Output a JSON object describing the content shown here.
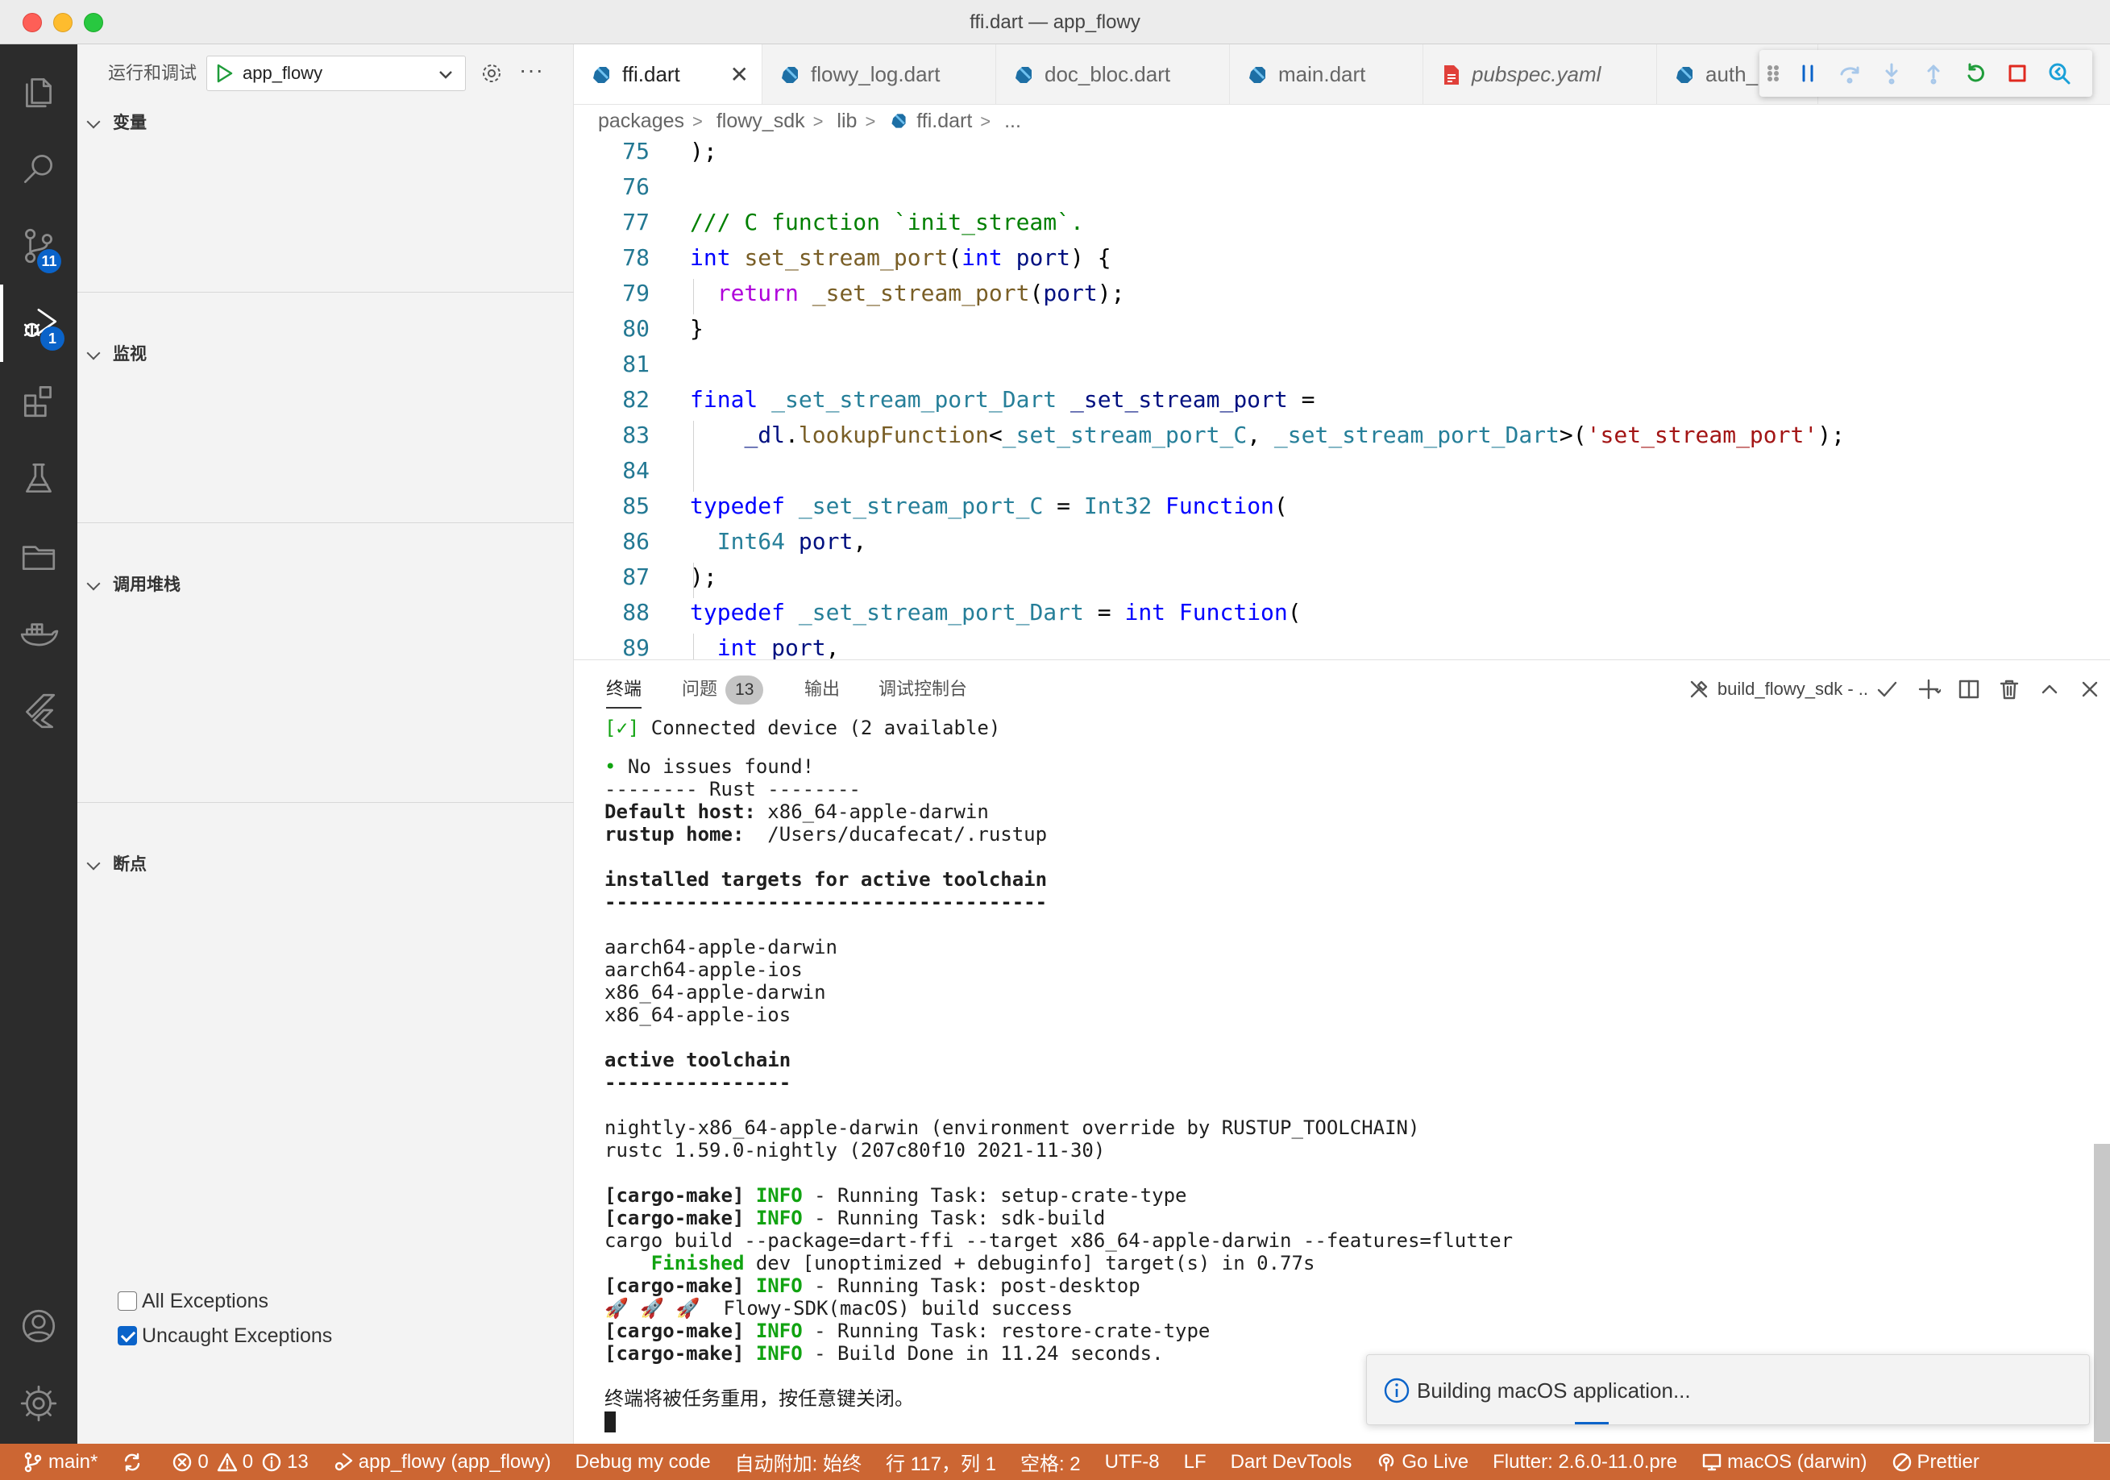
{
  "window": {
    "title": "ffi.dart — app_flowy"
  },
  "activity_bar": {
    "source_control_badge": "11",
    "debug_badge": "1"
  },
  "sidebar": {
    "run_label": "运行和调试",
    "config": "app_flowy",
    "sections": {
      "variables": "变量",
      "watch": "监视",
      "call_stack": "调用堆栈",
      "breakpoints": "断点"
    },
    "breakpoints": [
      {
        "label": "All Exceptions",
        "checked": false
      },
      {
        "label": "Uncaught Exceptions",
        "checked": true
      }
    ]
  },
  "tabs": [
    {
      "label": "ffi.dart",
      "active": true,
      "icon": "dart-icon"
    },
    {
      "label": "flowy_log.dart",
      "active": false,
      "icon": "dart-icon"
    },
    {
      "label": "doc_bloc.dart",
      "active": false,
      "icon": "dart-icon"
    },
    {
      "label": "main.dart",
      "active": false,
      "icon": "dart-icon"
    },
    {
      "label": "pubspec.yaml",
      "active": false,
      "icon": "yaml-icon"
    },
    {
      "label": "auth_",
      "active": false,
      "icon": "dart-icon"
    }
  ],
  "breadcrumb": [
    "packages",
    "flowy_sdk",
    "lib",
    "ffi.dart",
    "..."
  ],
  "code_lines": [
    {
      "n": "75",
      "text": ");"
    },
    {
      "n": "76",
      "text": ""
    },
    {
      "n": "77",
      "text": "/// C function `init_stream`."
    },
    {
      "n": "78",
      "text": "int set_stream_port(int port) {"
    },
    {
      "n": "79",
      "text": "  return _set_stream_port(port);"
    },
    {
      "n": "80",
      "text": "}"
    },
    {
      "n": "81",
      "text": ""
    },
    {
      "n": "82",
      "text": "final _set_stream_port_Dart _set_stream_port ="
    },
    {
      "n": "83",
      "text": "    _dl.lookupFunction<_set_stream_port_C, _set_stream_port_Dart>('set_stream_port');"
    },
    {
      "n": "84",
      "text": ""
    },
    {
      "n": "85",
      "text": "typedef _set_stream_port_C = Int32 Function("
    },
    {
      "n": "86",
      "text": "  Int64 port,"
    },
    {
      "n": "87",
      "text": ");"
    },
    {
      "n": "88",
      "text": "typedef _set_stream_port_Dart = int Function("
    },
    {
      "n": "89",
      "text": "  int port,"
    }
  ],
  "panel": {
    "tabs": {
      "terminal": "终端",
      "problems": "问题",
      "problems_count": "13",
      "output": "输出",
      "debug_console": "调试控制台"
    },
    "task_name": "build_flowy_sdk - ..",
    "terminal_lines": [
      "[✓] Connected device (2 available)",
      "",
      "• No issues found!",
      "-------- Rust --------",
      "Default host: x86_64-apple-darwin",
      "rustup home:  /Users/ducafecat/.rustup",
      "",
      "installed targets for active toolchain",
      "--------------------------------------",
      "",
      "aarch64-apple-darwin",
      "aarch64-apple-ios",
      "x86_64-apple-darwin",
      "x86_64-apple-ios",
      "",
      "active toolchain",
      "----------------",
      "",
      "nightly-x86_64-apple-darwin (environment override by RUSTUP_TOOLCHAIN)",
      "rustc 1.59.0-nightly (207c80f10 2021-11-30)",
      "",
      "[cargo-make] INFO - Running Task: setup-crate-type",
      "[cargo-make] INFO - Running Task: sdk-build",
      "cargo build --package=dart-ffi --target x86_64-apple-darwin --features=flutter",
      "    Finished dev [unoptimized + debuginfo] target(s) in 0.77s",
      "[cargo-make] INFO - Running Task: post-desktop",
      "🚀 🚀 🚀  Flowy-SDK(macOS) build success",
      "[cargo-make] INFO - Running Task: restore-crate-type",
      "[cargo-make] INFO - Build Done in 11.24 seconds.",
      "",
      "终端将被任务重用，按任意键关闭。"
    ]
  },
  "notification": {
    "text": "Building macOS application..."
  },
  "statusbar": {
    "branch": "main*",
    "errors": "0",
    "warnings": "0",
    "infos": "13",
    "debug_target": "app_flowy (app_flowy)",
    "debug_mode": "Debug my code",
    "auto_attach": "自动附加: 始终",
    "position": "行 117，列 1",
    "spaces": "空格: 2",
    "encoding": "UTF-8",
    "eol": "LF",
    "devtools": "Dart DevTools",
    "golive": "Go Live",
    "flutter": "Flutter: 2.6.0-11.0.pre",
    "device": "macOS (darwin)",
    "prettier": "Prettier"
  },
  "colors": {
    "statusbar": "#cc6633",
    "accent": "#0a63c9",
    "activity_bar": "#2c2c2c"
  }
}
